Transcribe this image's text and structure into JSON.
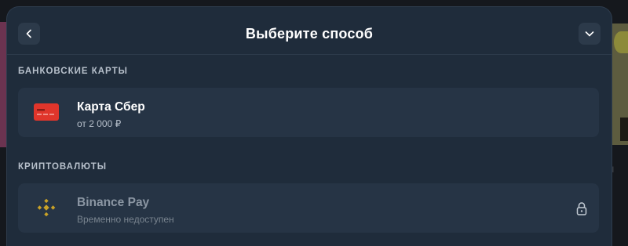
{
  "modal": {
    "title": "Выберите способ",
    "back_icon": "chevron-left-icon",
    "collapse_icon": "chevron-down-icon"
  },
  "sections": [
    {
      "label": "БАНКОВСКИЕ КАРТЫ",
      "methods": [
        {
          "name": "Карта Сбер",
          "subtitle": "от 2 000 ₽",
          "icon": "bank-card-icon",
          "icon_color": "#e0352b",
          "available": true
        }
      ]
    },
    {
      "label": "КРИПТОВАЛЮТЫ",
      "methods": [
        {
          "name": "Binance Pay",
          "subtitle": "Временно недоступен",
          "icon": "binance-icon",
          "icon_color": "#c9a227",
          "available": false,
          "status_icon": "lock-icon"
        }
      ]
    }
  ],
  "background": {
    "right_text": "l"
  },
  "colors": {
    "modal_bg": "#1f2c3b",
    "card_bg": "#263445",
    "accent_card": "#e0352b",
    "binance": "#c9a227"
  }
}
